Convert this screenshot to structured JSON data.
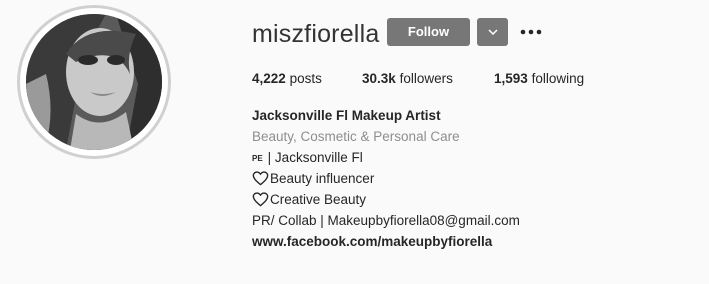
{
  "profile": {
    "username": "miszfiorella",
    "follow_label": "Follow"
  },
  "icons": {
    "dropdown": "chevron-down-icon",
    "more": "more-options-icon",
    "heart": "heart-outline-icon"
  },
  "stats": {
    "posts_count": "4,222",
    "posts_label": "posts",
    "followers_count": "30.3k",
    "followers_label": "followers",
    "following_count": "1,593",
    "following_label": "following"
  },
  "bio": {
    "full_name": "Jacksonville Fl Makeup Artist",
    "category": "Beauty, Cosmetic & Personal Care",
    "location_badge": "PE",
    "location_text": "| Jacksonville Fl",
    "line_heart_1": "Beauty influencer",
    "line_heart_2": "Creative Beauty",
    "contact": "PR/ Collab | Makeupbyfiorella08@gmail.com",
    "website": "www.facebook.com/makeupbyfiorella"
  },
  "colors": {
    "follow_button": "#777777",
    "category_text": "#8e8e8e",
    "page_background": "#fafafa"
  }
}
